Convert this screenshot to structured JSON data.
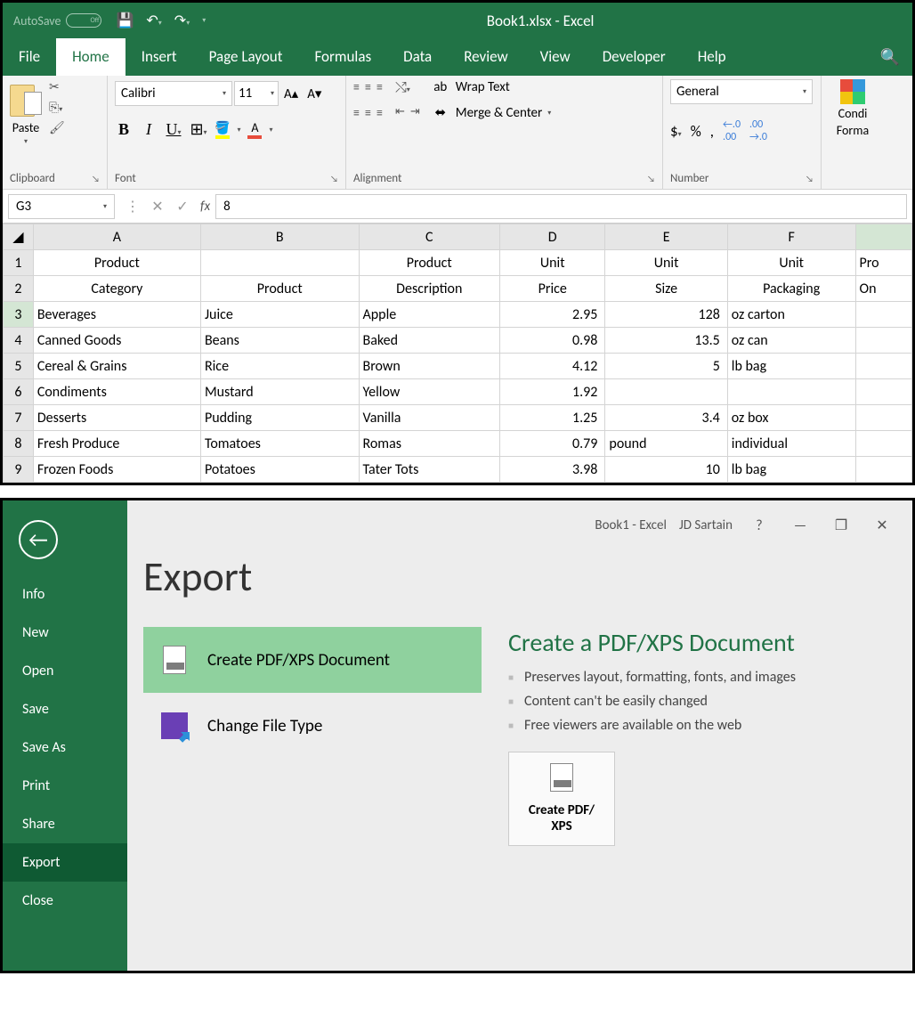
{
  "titlebar": {
    "autosave_label": "AutoSave",
    "autosave_state": "Off",
    "title": "Book1.xlsx  -  Excel"
  },
  "menu": {
    "tabs": [
      "File",
      "Home",
      "Insert",
      "Page Layout",
      "Formulas",
      "Data",
      "Review",
      "View",
      "Developer",
      "Help"
    ],
    "active": "Home"
  },
  "ribbon": {
    "clipboard": {
      "paste": "Paste",
      "label": "Clipboard"
    },
    "font": {
      "name": "Calibri",
      "size": "11",
      "label": "Font"
    },
    "alignment": {
      "wrap": "Wrap Text",
      "merge": "Merge & Center",
      "label": "Alignment"
    },
    "number": {
      "format": "General",
      "label": "Number"
    },
    "cond": {
      "label": "Conditional Formatting"
    },
    "cond_short1": "Condi",
    "cond_short2": "Forma"
  },
  "formula_bar": {
    "name_box": "G3",
    "value": "8"
  },
  "columns": [
    "A",
    "B",
    "C",
    "D",
    "E",
    "F",
    ""
  ],
  "header_row1": [
    "Product",
    "",
    "Product",
    "Unit",
    "Unit",
    "Unit",
    "Pro"
  ],
  "header_row2": [
    "Category",
    "Product",
    "Description",
    "Price",
    "Size",
    "Packaging",
    "On "
  ],
  "rows": [
    {
      "n": "3",
      "a": "Beverages",
      "b": "Juice",
      "c": "Apple",
      "d": "2.95",
      "e": "128",
      "f": "oz carton",
      "g": ""
    },
    {
      "n": "4",
      "a": "Canned Goods",
      "b": "Beans",
      "c": "Baked",
      "d": "0.98",
      "e": "13.5",
      "f": "oz can",
      "g": ""
    },
    {
      "n": "5",
      "a": "Cereal & Grains",
      "b": "Rice",
      "c": "Brown",
      "d": "4.12",
      "e": "5",
      "f": "lb bag",
      "g": ""
    },
    {
      "n": "6",
      "a": "Condiments",
      "b": "Mustard",
      "c": "Yellow",
      "d": "1.92",
      "e": "",
      "f": "",
      "g": ""
    },
    {
      "n": "7",
      "a": "Desserts",
      "b": "Pudding",
      "c": "Vanilla",
      "d": "1.25",
      "e": "3.4",
      "f": "oz box",
      "g": ""
    },
    {
      "n": "8",
      "a": "Fresh Produce",
      "b": "Tomatoes",
      "c": "Romas",
      "d": "0.79",
      "e": "pound",
      "f": "individual",
      "g": ""
    },
    {
      "n": "9",
      "a": "Frozen Foods",
      "b": "Potatoes",
      "c": "Tater Tots",
      "d": "3.98",
      "e": "10",
      "f": "lb bag",
      "g": ""
    }
  ],
  "backstage": {
    "titlebar": {
      "doc": "Book1  -  Excel",
      "user": "JD Sartain"
    },
    "heading": "Export",
    "sidebar": [
      "Info",
      "New",
      "Open",
      "Save",
      "Save As",
      "Print",
      "Share",
      "Export",
      "Close"
    ],
    "sidebar_active": "Export",
    "options": {
      "pdf": "Create PDF/XPS Document",
      "change": "Change File Type"
    },
    "detail": {
      "title": "Create a PDF/XPS Document",
      "bullets": [
        "Preserves layout, formatting, fonts, and images",
        "Content can't be easily changed",
        "Free viewers are available on the web"
      ],
      "button": "Create PDF/\nXPS"
    }
  }
}
